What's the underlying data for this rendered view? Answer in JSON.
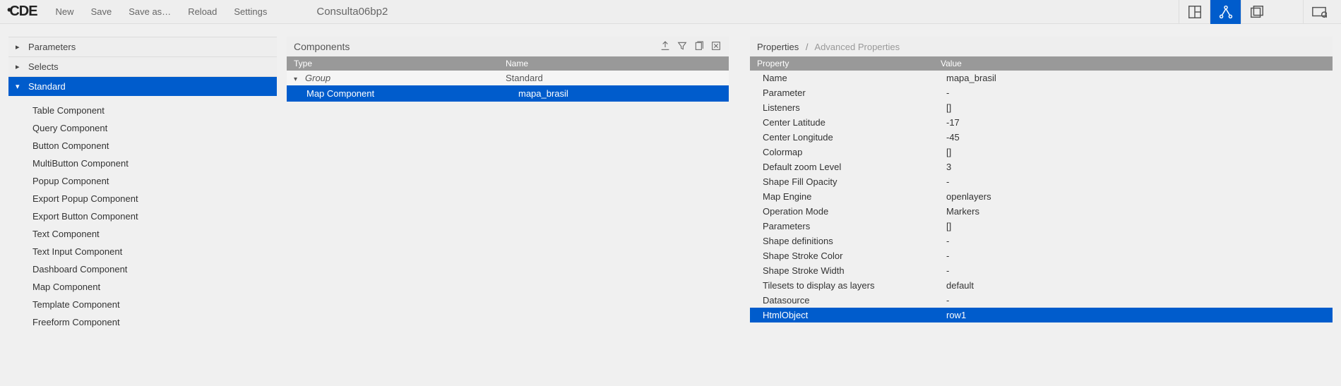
{
  "app": {
    "logo_text": "CDE",
    "title": "Consulta06bp2"
  },
  "menu": [
    "New",
    "Save",
    "Save as…",
    "Reload",
    "Settings"
  ],
  "left_accordion": [
    {
      "label": "Parameters",
      "expanded": false
    },
    {
      "label": "Selects",
      "expanded": false
    },
    {
      "label": "Standard",
      "expanded": true,
      "children": [
        "Table Component",
        "Query Component",
        "Button Component",
        "MultiButton Component",
        "Popup Component",
        "Export Popup Component",
        "Export Button Component",
        "Text Component",
        "Text Input Component",
        "Dashboard Component",
        "Map Component",
        "Template Component",
        "Freeform Component"
      ]
    }
  ],
  "components": {
    "title": "Components",
    "cols": {
      "c1": "Type",
      "c2": "Name"
    },
    "group": {
      "label": "Group",
      "name": "Standard"
    },
    "selected": {
      "type": "Map Component",
      "name": "mapa_brasil"
    }
  },
  "properties": {
    "crumb1": "Properties",
    "crumb2": "Advanced Properties",
    "cols": {
      "c1": "Property",
      "c2": "Value"
    },
    "rows": [
      {
        "k": "Name",
        "v": "mapa_brasil"
      },
      {
        "k": "Parameter",
        "v": "-"
      },
      {
        "k": "Listeners",
        "v": "[]"
      },
      {
        "k": "Center Latitude",
        "v": "-17"
      },
      {
        "k": "Center Longitude",
        "v": "-45"
      },
      {
        "k": "Colormap",
        "v": "[]"
      },
      {
        "k": "Default zoom Level",
        "v": "3"
      },
      {
        "k": "Shape Fill Opacity",
        "v": "-"
      },
      {
        "k": "Map Engine",
        "v": "openlayers"
      },
      {
        "k": "Operation Mode",
        "v": "Markers"
      },
      {
        "k": "Parameters",
        "v": "[]"
      },
      {
        "k": "Shape definitions",
        "v": "-"
      },
      {
        "k": "Shape Stroke Color",
        "v": "-"
      },
      {
        "k": "Shape Stroke Width",
        "v": "-"
      },
      {
        "k": "Tilesets to display as layers",
        "v": "default"
      },
      {
        "k": "Datasource",
        "v": "-"
      },
      {
        "k": "HtmlObject",
        "v": "row1",
        "sel": true
      }
    ]
  }
}
